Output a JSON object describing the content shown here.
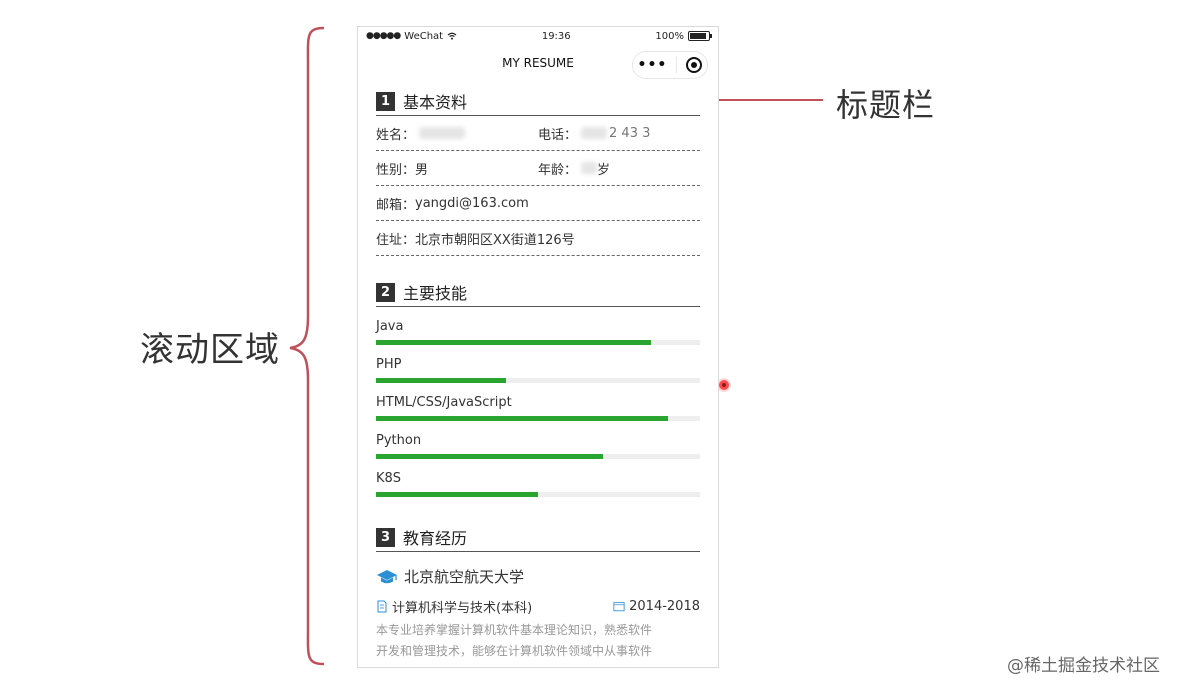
{
  "annotations": {
    "scroll_area_label": "滚动区域",
    "title_bar_label": "标题栏",
    "watermark": "@稀土掘金技术社区"
  },
  "statusbar": {
    "carrier": "WeChat",
    "time": "19:36",
    "battery": "100%"
  },
  "navbar": {
    "title": "MY RESUME"
  },
  "sections": {
    "basic": {
      "num": "1",
      "title": "基本资料"
    },
    "skills": {
      "num": "2",
      "title": "主要技能"
    },
    "education": {
      "num": "3",
      "title": "教育经历"
    }
  },
  "basic_info": {
    "name_label": "姓名：",
    "phone_label": "电话：",
    "phone_fragment": "2  43  3",
    "gender_label": "性别：",
    "gender_value": "男",
    "age_label": "年龄：",
    "age_fragment": "岁",
    "email_label": "邮箱：",
    "email_value": "yangdi@163.com",
    "address_label": "住址：",
    "address_value": "北京市朝阳区XX街道126号"
  },
  "skills": [
    {
      "name": "Java",
      "level": 0.85
    },
    {
      "name": "PHP",
      "level": 0.4
    },
    {
      "name": "HTML/CSS/JavaScript",
      "level": 0.9
    },
    {
      "name": "Python",
      "level": 0.7
    },
    {
      "name": "K8S",
      "level": 0.5
    }
  ],
  "education": {
    "school": "北京航空航天大学",
    "major": "计算机科学与技术(本科)",
    "period": "2014-2018",
    "description_line1": "本专业培养掌握计算机软件基本理论知识，熟悉软件",
    "description_line2": "开发和管理技术，能够在计算机软件领域中从事软件"
  },
  "colors": {
    "skill_bar": "#2aa52f",
    "brace": "#c0505a",
    "icon_blue": "#2b8fd6"
  }
}
